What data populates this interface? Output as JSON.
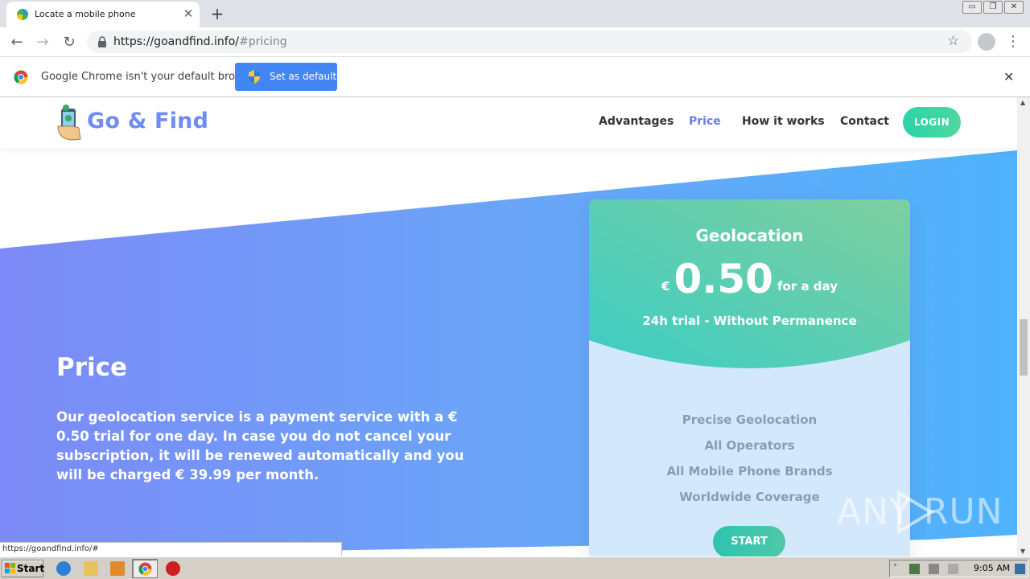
{
  "browser": {
    "tab_title": "Locate a mobile phone",
    "tab_close": "✕",
    "new_tab": "+",
    "url_host": "https://goandfind.info/",
    "url_path": "#pricing",
    "window_controls": [
      "▭",
      "❐",
      "✕"
    ]
  },
  "infobar": {
    "message": "Google Chrome isn't your default browser",
    "button_label": "Set as default",
    "close": "✕"
  },
  "site": {
    "logo_text": "Go & Find",
    "nav": [
      {
        "label": "Advantages",
        "active": false
      },
      {
        "label": "Price",
        "active": true
      },
      {
        "label": "How it works",
        "active": false
      },
      {
        "label": "Contact",
        "active": false
      }
    ],
    "login_label": "LOGIN"
  },
  "pricing": {
    "title": "Price",
    "description": "Our geolocation service is a payment service with a € 0.50 trial for one day. In case you do not cancel your subscription, it will be renewed automatically and you will be charged € 39.99 per month.",
    "card": {
      "name": "Geolocation",
      "currency": "€",
      "amount": "0.50",
      "period": "for a day",
      "trial": "24h trial - Without Permanence",
      "features": [
        "Precise Geolocation",
        "All Operators",
        "All Mobile Phone Brands",
        "Worldwide Coverage"
      ],
      "button_label": "START"
    }
  },
  "status_bar_url": "https://goandfind.info/#",
  "watermark": "ANY  RUN",
  "taskbar": {
    "start_label": "Start",
    "clock": "9:05 AM"
  },
  "colors": {
    "accent": "#6b7fe8",
    "card_gradient_start": "#7ecf9e",
    "card_gradient_end": "#3ccdc4",
    "hero_left": "#7c8af7",
    "hero_right": "#4fb3fb"
  }
}
